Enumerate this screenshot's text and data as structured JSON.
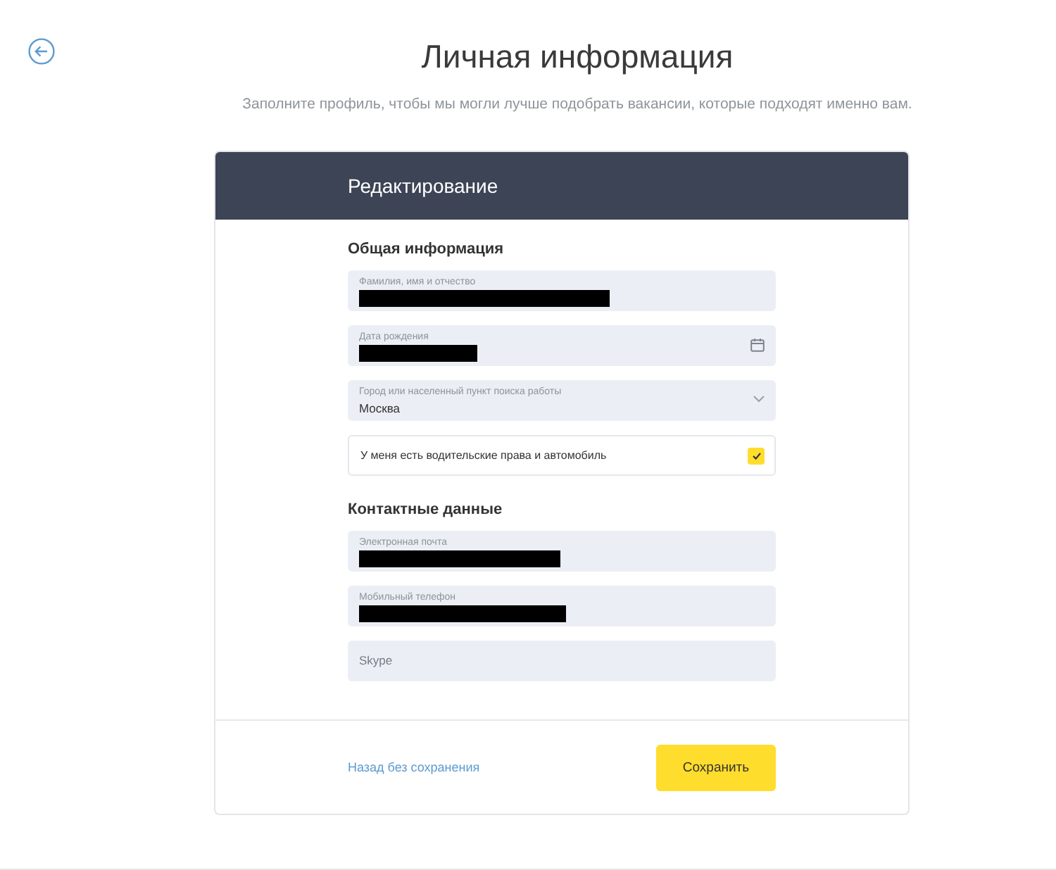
{
  "page": {
    "title": "Личная информация",
    "subtitle": "Заполните профиль, чтобы мы могли лучше подобрать вакансии, которые подходят именно вам."
  },
  "card": {
    "title": "Редактирование",
    "sections": [
      {
        "heading": "Общая информация",
        "fields": [
          {
            "kind": "text",
            "label": "Фамилия, имя и отчество",
            "redacted": true
          },
          {
            "kind": "date",
            "label": "Дата рождения",
            "redacted": true
          },
          {
            "kind": "select",
            "label": "Город или населенный пункт поиска работы",
            "value": "Москва"
          },
          {
            "kind": "checkbox",
            "label": "У меня есть водительские права и автомобиль",
            "checked": true
          }
        ]
      },
      {
        "heading": "Контактные данные",
        "fields": [
          {
            "kind": "text",
            "label": "Электронная почта",
            "redacted": true
          },
          {
            "kind": "text",
            "label": "Мобильный телефон",
            "redacted": true
          },
          {
            "kind": "text",
            "placeholder": "Skype"
          }
        ]
      }
    ],
    "cancel_link": "Назад без сохранения",
    "save_button": "Сохранить"
  }
}
